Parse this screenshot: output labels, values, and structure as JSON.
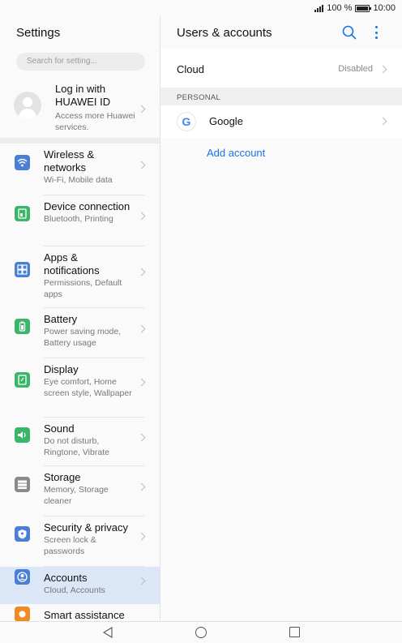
{
  "status": {
    "battery_percent": "100 %",
    "time": "10:00",
    "battery_level": 1.0
  },
  "left": {
    "title": "Settings",
    "search_placeholder": "Search for setting...",
    "login": {
      "title": "Log in with HUAWEI ID",
      "subtitle": "Access more Huawei services."
    },
    "items": [
      {
        "label": "Wireless & networks",
        "sub": "Wi-Fi, Mobile data",
        "icon": "wifi-icon",
        "color": "#4a7fd6"
      },
      {
        "label": "Device connection",
        "sub": "Bluetooth, Printing",
        "icon": "device-connection-icon",
        "color": "#3bb56a"
      },
      {
        "label": "Apps & notifications",
        "sub": "Permissions, Default apps",
        "icon": "apps-icon",
        "color": "#4a7fd6"
      },
      {
        "label": "Battery",
        "sub": "Power saving mode, Battery usage",
        "icon": "battery-icon",
        "color": "#3bb56a"
      },
      {
        "label": "Display",
        "sub": "Eye comfort, Home screen style, Wallpaper",
        "icon": "display-icon",
        "color": "#3bb56a"
      },
      {
        "label": "Sound",
        "sub": "Do not disturb, Ringtone, Vibrate",
        "icon": "sound-icon",
        "color": "#3bb56a"
      },
      {
        "label": "Storage",
        "sub": "Memory, Storage cleaner",
        "icon": "storage-icon",
        "color": "#8a8a8a"
      },
      {
        "label": "Security & privacy",
        "sub": "Screen lock & passwords",
        "icon": "shield-icon",
        "color": "#4a7fd6"
      },
      {
        "label": "Accounts",
        "sub": "Cloud, Accounts",
        "icon": "account-icon",
        "color": "#4a7fd6"
      },
      {
        "label": "Smart assistance",
        "sub": "",
        "icon": "smart-assistance-icon",
        "color": "#f08a24"
      }
    ]
  },
  "right": {
    "title": "Users & accounts",
    "cloud": {
      "label": "Cloud",
      "value": "Disabled"
    },
    "section_label": "PERSONAL",
    "google": {
      "label": "Google",
      "logo": "G"
    },
    "add_account": "Add account",
    "accent": "#1a73e8"
  },
  "nav": {
    "back": "back-icon",
    "home": "home-icon",
    "recent": "recent-apps-icon"
  }
}
